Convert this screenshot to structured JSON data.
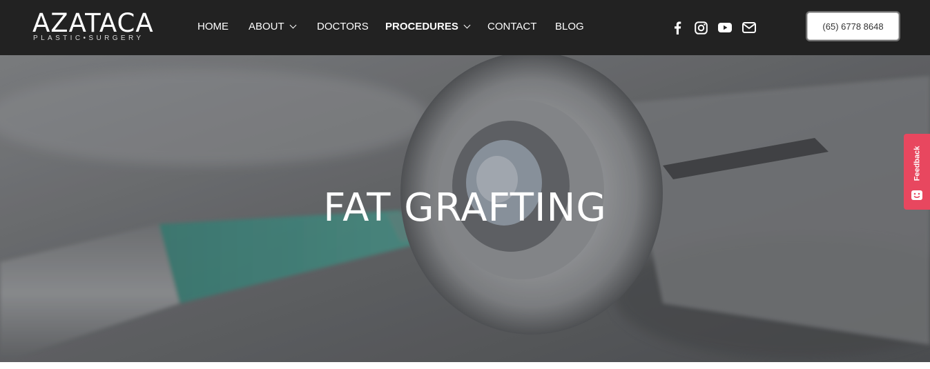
{
  "brand": {
    "name": "AZATACA",
    "tagline": "PLASTIC•SURGERY"
  },
  "nav": {
    "items": [
      {
        "label": "HOME",
        "has_dropdown": false,
        "active": false
      },
      {
        "label": "ABOUT",
        "has_dropdown": true,
        "active": false
      },
      {
        "label": "DOCTORS",
        "has_dropdown": false,
        "active": false
      },
      {
        "label": "PROCEDURES",
        "has_dropdown": true,
        "active": true
      },
      {
        "label": "CONTACT",
        "has_dropdown": false,
        "active": false
      },
      {
        "label": "BLOG",
        "has_dropdown": false,
        "active": false
      }
    ]
  },
  "social": {
    "icons": [
      "facebook-icon",
      "instagram-icon",
      "youtube-icon",
      "email-icon"
    ]
  },
  "header": {
    "phone": "(65) 6778 8648"
  },
  "hero": {
    "title": "FAT GRAFTING"
  },
  "feedback": {
    "label": "Feedback",
    "color": "#e8475f"
  },
  "colors": {
    "header_bg": "#222222",
    "text": "#ffffff"
  }
}
